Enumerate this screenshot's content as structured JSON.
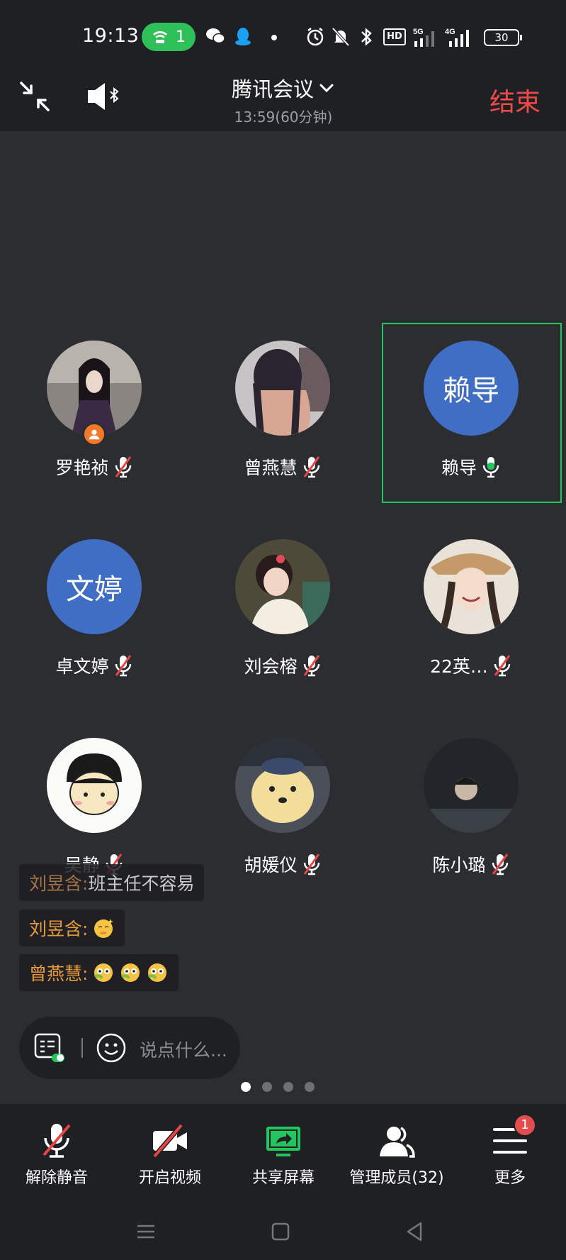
{
  "status_bar": {
    "time": "19:13",
    "hotspot_count": "1",
    "battery": "30",
    "icons": [
      "wifi-hotspot-icon",
      "wechat-icon",
      "qq-icon",
      "dot-icon",
      "alarm-icon",
      "mute-bell-icon",
      "bluetooth-icon",
      "hd-icon",
      "5g-signal-icon",
      "4g-signal-icon",
      "battery-icon"
    ]
  },
  "header": {
    "title": "腾讯会议",
    "subtitle": "13:59(60分钟)",
    "end_label": "结束",
    "end_color": "#f04a4a"
  },
  "participants": [
    {
      "name": "罗艳祯",
      "avatar_text": "",
      "muted": true,
      "host": true
    },
    {
      "name": "曾燕慧",
      "avatar_text": "",
      "muted": true
    },
    {
      "name": "赖导",
      "avatar_text": "赖导",
      "muted": false,
      "speaking": true
    },
    {
      "name": "卓文婷",
      "avatar_text": "文婷",
      "muted": true
    },
    {
      "name": "刘会榕",
      "avatar_text": "",
      "muted": true
    },
    {
      "name": "22英…",
      "avatar_text": "",
      "muted": true
    },
    {
      "name": "吴静",
      "avatar_text": "",
      "muted": true
    },
    {
      "name": "胡媛仪",
      "avatar_text": "",
      "muted": true
    },
    {
      "name": "陈小璐",
      "avatar_text": "",
      "muted": true
    }
  ],
  "chat": [
    {
      "sender": "刘昱含:",
      "text": " 班主任不容易"
    },
    {
      "sender": "刘昱含:",
      "text": ""
    },
    {
      "sender": "曾燕慧:",
      "text": ""
    }
  ],
  "input": {
    "placeholder": "说点什么..."
  },
  "pagination": {
    "total": 4,
    "active": 1
  },
  "toolbar": {
    "unmute": "解除静音",
    "video": "开启视频",
    "share": "共享屏幕",
    "members": "管理成员(32)",
    "more": "更多",
    "more_badge": "1",
    "share_color": "#22c55e"
  },
  "colors": {
    "accent_green": "#22c55e",
    "avatar_blue": "#3f6ec4",
    "chat_orange": "#e69a3a"
  }
}
